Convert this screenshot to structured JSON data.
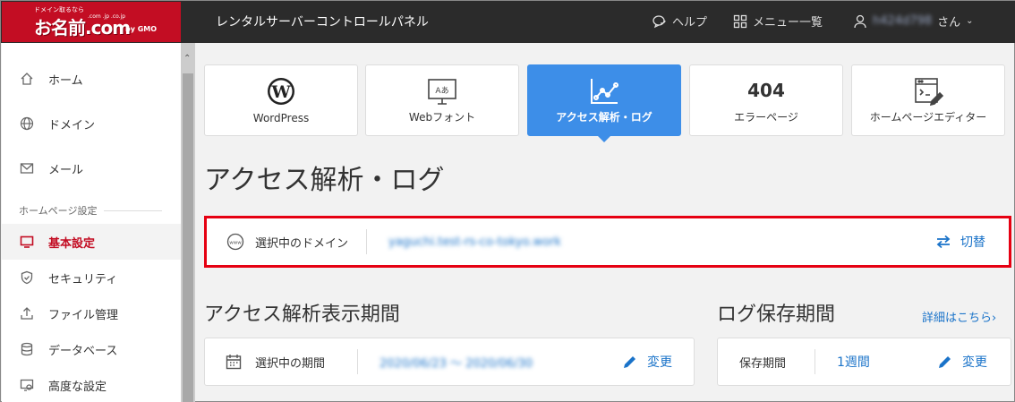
{
  "header": {
    "logo_tagline": "ドメイン取るなら",
    "logo_text": "お名前.com",
    "logo_sub": ".com .jp .co.jp",
    "logo_gmo": "by GMO",
    "app_title": "レンタルサーバーコントロールパネル",
    "help_label": "ヘルプ",
    "menu_label": "メニュー一覧",
    "user_name": "h424d798",
    "user_suffix": "さん"
  },
  "sidebar": {
    "items": [
      {
        "label": "ホーム",
        "icon": "home-icon"
      },
      {
        "label": "ドメイン",
        "icon": "globe-icon"
      },
      {
        "label": "メール",
        "icon": "mail-icon"
      }
    ],
    "section_label": "ホームページ設定",
    "sub_items": [
      {
        "label": "基本設定",
        "icon": "monitor-icon",
        "active": true
      },
      {
        "label": "セキュリティ",
        "icon": "shield-icon"
      },
      {
        "label": "ファイル管理",
        "icon": "upload-icon"
      },
      {
        "label": "データベース",
        "icon": "database-icon"
      },
      {
        "label": "高度な設定",
        "icon": "settings-monitor-icon"
      }
    ]
  },
  "tools": [
    {
      "label": "WordPress",
      "icon": "wordpress-icon"
    },
    {
      "label": "Webフォント",
      "icon": "webfont-icon"
    },
    {
      "label": "アクセス解析・ログ",
      "icon": "analytics-icon",
      "active": true
    },
    {
      "label": "エラーページ",
      "icon_text": "404"
    },
    {
      "label": "ホームページエディター",
      "icon": "editor-icon"
    }
  ],
  "page_title": "アクセス解析・ログ",
  "domain": {
    "label": "選択中のドメイン",
    "value": "yaguchi.test-rs-co-tokyo.work",
    "switch_label": "切替"
  },
  "analysis": {
    "title": "アクセス解析表示期間",
    "period_label": "選択中の期間",
    "period_value": "2020/06/23 ～ 2020/06/30",
    "edit_label": "変更"
  },
  "log": {
    "title": "ログ保存期間",
    "detail_link": "詳細はこちら›",
    "retention_label": "保存期間",
    "retention_value": "1週間",
    "edit_label": "変更"
  },
  "colors": {
    "brand_red": "#c30d23",
    "active_blue": "#3d8ee8",
    "link_blue": "#1a73c9",
    "highlight_border": "#e60012"
  }
}
